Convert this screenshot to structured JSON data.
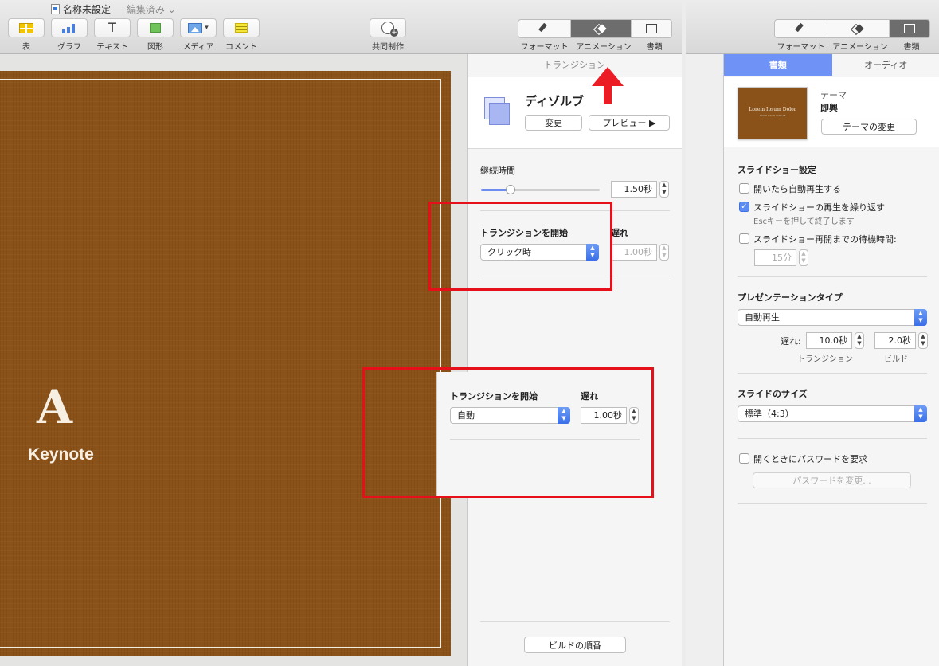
{
  "window": {
    "title": "名称未設定",
    "subtitle": "— 編集済み ⌄"
  },
  "toolbar": {
    "items": [
      "表",
      "グラフ",
      "テキスト",
      "図形",
      "メディア",
      "コメント"
    ],
    "collab_label": "共同制作",
    "segments": [
      "フォーマット",
      "アニメーション",
      "書類"
    ]
  },
  "slide": {
    "letter": "A",
    "name": "Keynote",
    "background_color": "#8a5219"
  },
  "transition_panel": {
    "header": "トランジション",
    "effect_name": "ディゾルブ",
    "change_button": "変更",
    "preview_button": "プレビュー ▶",
    "duration_label": "継続時間",
    "duration_value": "1.50秒",
    "duration_fraction": 0.25,
    "start_label": "トランジションを開始",
    "delay_label": "遅れ",
    "start_value": "クリック時",
    "delay_value": "1.00秒",
    "build_order_button": "ビルドの順番"
  },
  "callout": {
    "start_label": "トランジションを開始",
    "delay_label": "遅れ",
    "start_value": "自動",
    "delay_value": "1.00秒"
  },
  "document_panel": {
    "toolbar_segments": [
      "フォーマット",
      "アニメーション",
      "書類"
    ],
    "tabs": [
      "書類",
      "オーディオ"
    ],
    "theme_label": "テーマ",
    "theme_name": "即興",
    "theme_thumb_title": "Lorem Ipsum Dolor",
    "theme_thumb_sub": "Lorem ipsum dolor sit",
    "change_theme_button": "テーマの変更",
    "slideshow_settings_label": "スライドショー設定",
    "autoplay_label": "開いたら自動再生する",
    "autoplay_checked": false,
    "loop_label": "スライドショーの再生を繰り返す",
    "loop_checked": true,
    "loop_note": "Escキーを押して終了します",
    "idle_label": "スライドショー再開までの待機時間:",
    "idle_checked": false,
    "idle_value": "15分",
    "presentation_type_label": "プレゼンテーションタイプ",
    "presentation_type_value": "自動再生",
    "delay_label": "遅れ:",
    "transition_delay_value": "10.0秒",
    "build_delay_value": "2.0秒",
    "transition_caption": "トランジション",
    "build_caption": "ビルド",
    "slide_size_label": "スライドのサイズ",
    "slide_size_value": "標準（4:3）",
    "password_label": "開くときにパスワードを要求",
    "password_checked": false,
    "change_password_button": "パスワードを変更..."
  },
  "colors": {
    "accent": "#5a8cf2",
    "highlight_red": "#e5101a",
    "slide_brown": "#8a5219"
  }
}
